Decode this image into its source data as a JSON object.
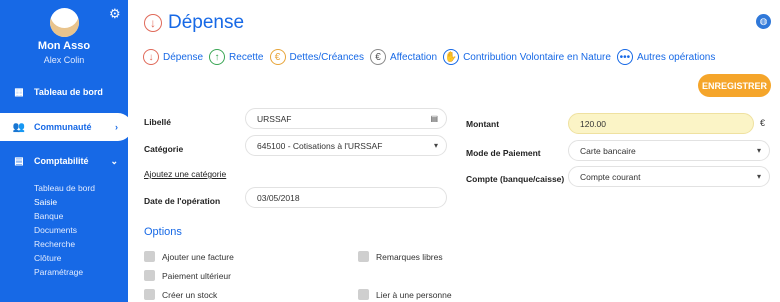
{
  "sidebar": {
    "org_name": "Mon Asso",
    "user_name": "Alex Colin",
    "items": [
      {
        "label": "Tableau de bord",
        "icon": "dashboard-icon"
      },
      {
        "label": "Communauté",
        "icon": "people-icon"
      },
      {
        "label": "Comptabilité",
        "icon": "calculator-icon"
      }
    ],
    "sub_items": [
      "Tableau de bord",
      "Saisie",
      "Banque",
      "Documents",
      "Recherche",
      "Clôture",
      "Paramétrage"
    ]
  },
  "header": {
    "title": "Dépense"
  },
  "types": [
    {
      "label": "Dépense",
      "icon": "arrow-down-icon"
    },
    {
      "label": "Recette",
      "icon": "arrow-up-icon"
    },
    {
      "label": "Dettes/Créances",
      "icon": "euro-icon"
    },
    {
      "label": "Affectation",
      "icon": "euro-split-icon"
    },
    {
      "label": "Contribution Volontaire en Nature",
      "icon": "hand-icon"
    },
    {
      "label": "Autres opérations",
      "icon": "more-icon"
    }
  ],
  "toolbar": {
    "save_label": "ENREGISTRER"
  },
  "form": {
    "libelle_label": "Libellé",
    "libelle_value": "URSSAF",
    "categorie_label": "Catégorie",
    "categorie_value": "645100 - Cotisations à l'URSSAF",
    "add_category_link": "Ajoutez une catégorie",
    "date_label": "Date de l'opération",
    "date_value": "03/05/2018",
    "montant_label": "Montant",
    "montant_value": "120.00",
    "currency": "€",
    "mode_label": "Mode de Paiement",
    "mode_value": "Carte bancaire",
    "compte_label": "Compte (banque/caisse)",
    "compte_value": "Compte courant"
  },
  "options": {
    "title": "Options",
    "left": [
      "Ajouter une facture",
      "Paiement ultérieur",
      "Créer un stock"
    ],
    "right": [
      "Remarques libres",
      "Lier à une personne"
    ]
  },
  "colors": {
    "primary": "#1769e6",
    "accent": "#f5a52a",
    "amount_bg": "#fbf4c6"
  }
}
